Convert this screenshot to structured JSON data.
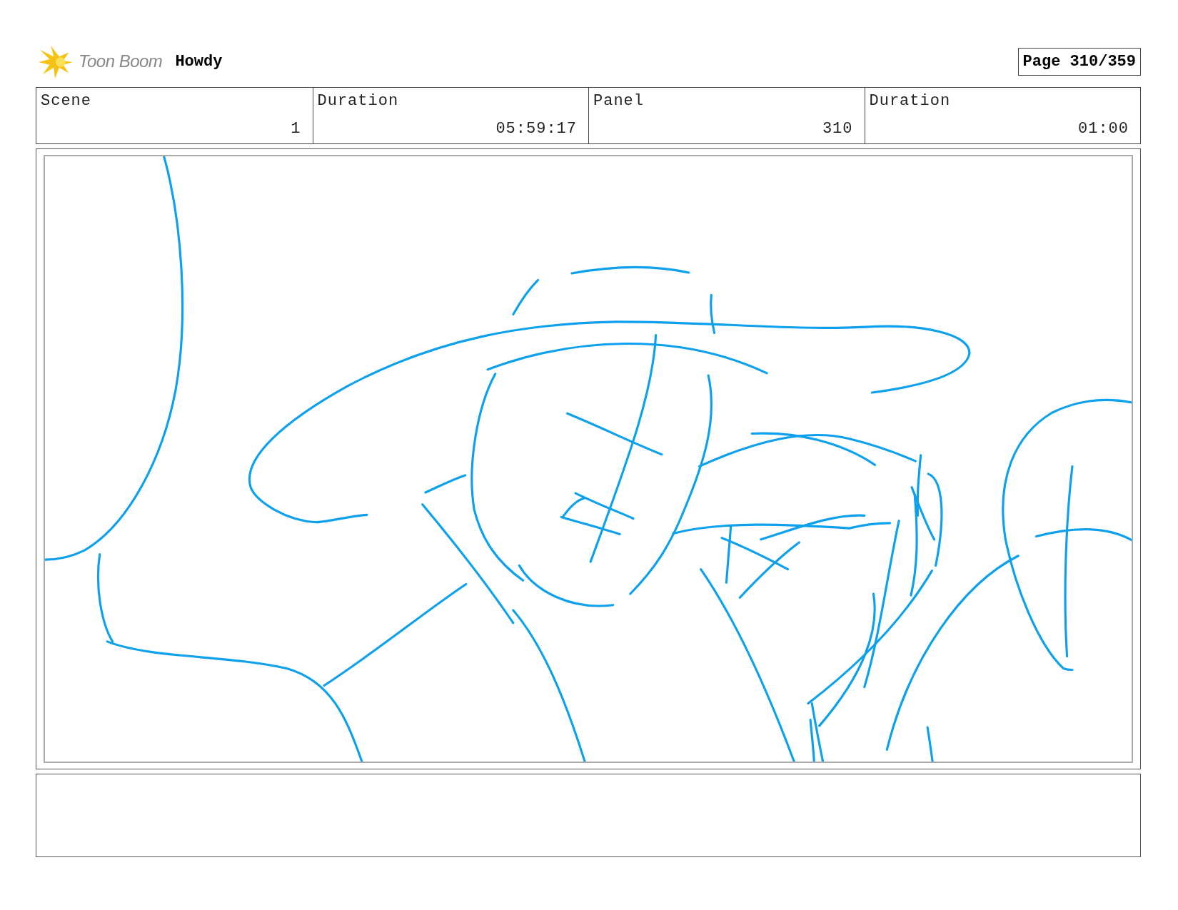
{
  "header": {
    "logo_text": "Toon Boom",
    "project": "Howdy",
    "page": "Page 310/359"
  },
  "info": [
    {
      "label": "Scene",
      "value": "1"
    },
    {
      "label": "Duration",
      "value": "05:59:17"
    },
    {
      "label": "Panel",
      "value": "310"
    },
    {
      "label": "Duration",
      "value": "01:00"
    }
  ]
}
